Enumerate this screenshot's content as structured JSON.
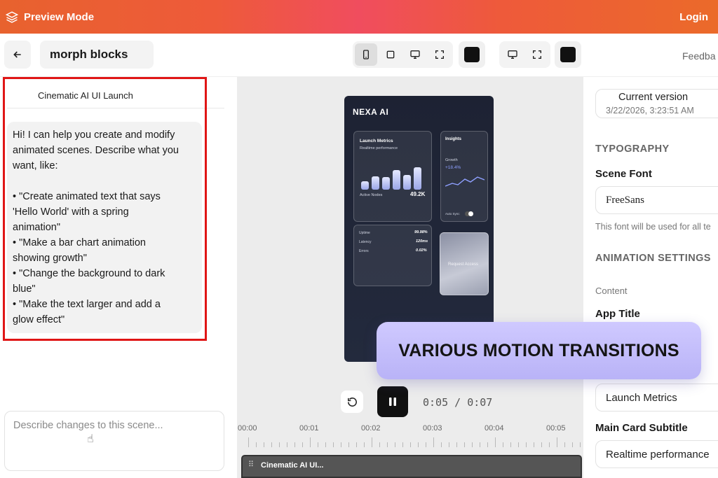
{
  "banner": {
    "title": "Preview Mode",
    "login": "Login",
    "gradient_start": "#e8622e",
    "gradient_mid": "#f04d5e"
  },
  "toolbar": {
    "project_name": "morph blocks",
    "feedback": "Feedba"
  },
  "chat": {
    "title": "Cinematic AI UI Launch",
    "message_lines": [
      "Hi! I can help you create and modify",
      "animated scenes. Describe what you",
      "want, like:",
      "",
      "• \"Create animated text that says",
      "'Hello World' with a spring",
      "animation\"",
      "• \"Make a bar chart animation",
      "showing growth\"",
      "• \"Change the background to dark",
      "blue\"",
      "• \"Make the text larger and add a",
      "glow effect\""
    ],
    "input_placeholder": "Describe changes to this scene..."
  },
  "preview": {
    "app_title": "NEXA AI",
    "card_title": "Launch Metrics",
    "card_subtitle": "Realtime performance",
    "metric_label": "Active Nodes",
    "metric_value": "49.2K",
    "bar_levels": [
      0.35,
      0.55,
      0.5,
      0.8,
      0.6,
      0.9
    ],
    "insights_title": "Insights",
    "growth_label": "Growth",
    "growth_value": "+18.4%",
    "auto_sync": "Auto Sync",
    "stats": [
      {
        "label": "Uptime",
        "value": "99.98%"
      },
      {
        "label": "Latency",
        "value": "120ms"
      },
      {
        "label": "Errors",
        "value": "0.02%"
      }
    ],
    "request_access": "Request Access"
  },
  "playback": {
    "current": "0:05",
    "sep": "/",
    "total": "0:07"
  },
  "timeline": {
    "ticks": [
      "00:00",
      "00:01",
      "00:02",
      "00:03",
      "00:04",
      "00:05"
    ],
    "clip_label": "Cinematic AI UI..."
  },
  "props": {
    "current_version": "Current version",
    "version_date": "3/22/2026, 3:23:51 AM",
    "typography_heading": "TYPOGRAPHY",
    "scene_font_label": "Scene Font",
    "scene_font_value": "FreeSans",
    "font_note": "This font will be used for all te",
    "animation_heading": "ANIMATION SETTINGS",
    "content_label": "Content",
    "app_title_label": "App Title",
    "main_card_title_value": "Launch Metrics",
    "main_card_subtitle_label": "Main Card Subtitle",
    "main_card_subtitle_value": "Realtime performance"
  },
  "overlay": {
    "text": "VARIOUS MOTION TRANSITIONS",
    "color": "#c9c3ff"
  },
  "icons": {
    "back": "arrow-left-icon",
    "brand": "layers-icon",
    "phone": "phone-icon",
    "square": "square-icon",
    "monitor": "monitor-icon",
    "fullscreen": "expand-icon",
    "reset": "rotate-ccw-icon",
    "pause": "pause-icon"
  }
}
